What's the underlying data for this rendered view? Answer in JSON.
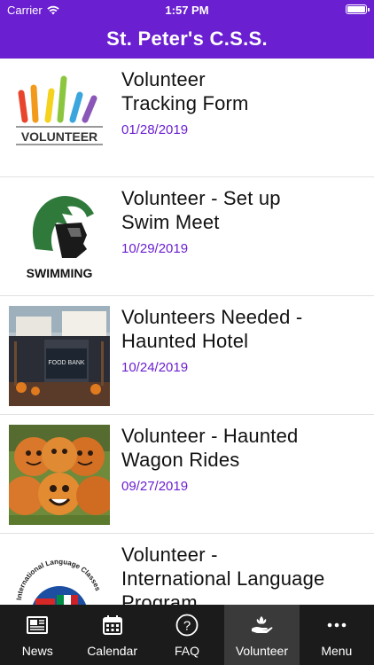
{
  "status_bar": {
    "carrier": "Carrier",
    "time": "1:57 PM"
  },
  "header": {
    "title": "St. Peter's C.S.S."
  },
  "feed": [
    {
      "title_line1": "Volunteer",
      "title_line2": "Tracking Form",
      "date": "01/28/2019",
      "thumb_text": "VOLUNTEER"
    },
    {
      "title_line1": "Volunteer - Set up",
      "title_line2": "Swim Meet",
      "date": "10/29/2019",
      "thumb_text": "SWIMMING"
    },
    {
      "title_line1": "Volunteers Needed -",
      "title_line2": "Haunted Hotel",
      "date": "10/24/2019",
      "thumb_text": "FOOD BANK"
    },
    {
      "title_line1": "Volunteer - Haunted",
      "title_line2": "Wagon Rides",
      "date": "09/27/2019"
    },
    {
      "title_line1": "Volunteer -",
      "title_line2": "International Language",
      "title_line3": "Program",
      "thumb_text": "International Language Classes"
    }
  ],
  "tabs": [
    {
      "label": "News",
      "icon": "newspaper-icon"
    },
    {
      "label": "Calendar",
      "icon": "calendar-icon"
    },
    {
      "label": "FAQ",
      "icon": "question-icon"
    },
    {
      "label": "Volunteer",
      "icon": "volunteer-hand-icon",
      "active": true
    },
    {
      "label": "Menu",
      "icon": "more-dots-icon"
    }
  ],
  "colors": {
    "brand_purple": "#6a1fd0",
    "tab_bar": "#1b1b1b",
    "tab_active": "#3a3a3a",
    "date_text": "#6a1fd0"
  }
}
